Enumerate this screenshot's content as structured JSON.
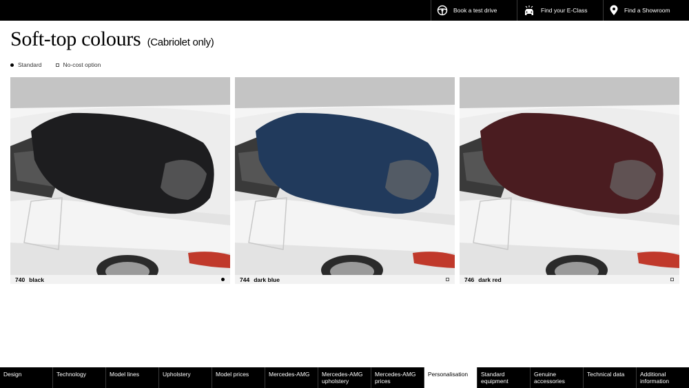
{
  "header": {
    "book_test_drive": "Book a test drive",
    "find_eclass": "Find your E-Class",
    "find_showroom": "Find a Showroom"
  },
  "page": {
    "title": "Soft-top colours",
    "subtitle": "(Cabriolet only)"
  },
  "legend": {
    "standard": "Standard",
    "no_cost": "No-cost option"
  },
  "options": [
    {
      "code": "740",
      "name": "black",
      "top_color": "#1d1d1f",
      "availability": "standard"
    },
    {
      "code": "744",
      "name": "dark blue",
      "top_color": "#213a5c",
      "availability": "no-cost option"
    },
    {
      "code": "746",
      "name": "dark red",
      "top_color": "#4a1c20",
      "availability": "no-cost option"
    }
  ],
  "nav": [
    {
      "label": "Design"
    },
    {
      "label": "Technology"
    },
    {
      "label": "Model lines"
    },
    {
      "label": "Upholstery"
    },
    {
      "label": "Model prices"
    },
    {
      "label": "Mercedes-AMG"
    },
    {
      "label": "Mercedes-AMG\nupholstery"
    },
    {
      "label": "Mercedes-AMG\nprices"
    },
    {
      "label": "Personalisation",
      "active": true
    },
    {
      "label": "Standard\nequipment"
    },
    {
      "label": "Genuine\naccessories"
    },
    {
      "label": "Technical data"
    },
    {
      "label": "Additional\ninformation"
    }
  ],
  "colors": {
    "bar_background": "#000000",
    "label_background": "#f2f2f2",
    "car_body": "#e9e9e9"
  }
}
